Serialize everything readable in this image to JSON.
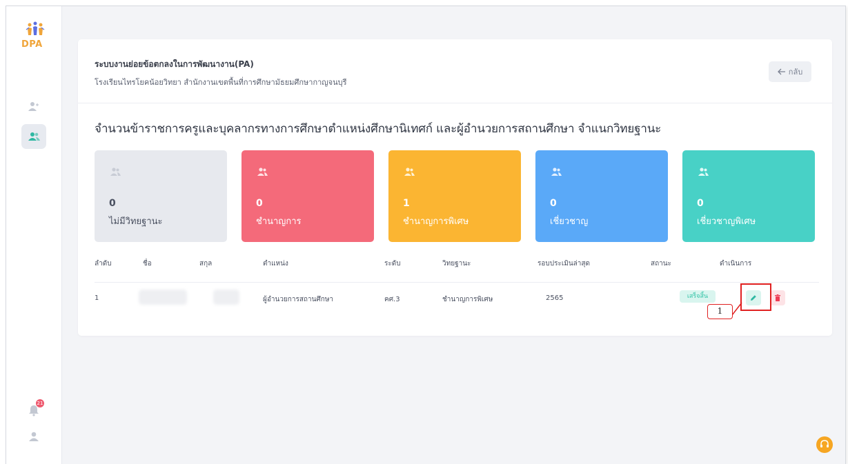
{
  "sidebar": {
    "logo_text": "DPA",
    "items": [
      {
        "name": "add-user",
        "icon": "user-plus-icon"
      },
      {
        "name": "users",
        "icon": "users-icon",
        "active": true
      }
    ],
    "notifications_count": "21"
  },
  "header": {
    "system_title": "ระบบงานย่อยข้อตกลงในการพัฒนางาน(PA)",
    "school": "โรงเรียนไทรโยคน้อยวิทยา สำนักงานเขตพื้นที่การศึกษามัธยมศึกษากาญจนบุรี",
    "back_label": "กลับ"
  },
  "main": {
    "title": "จำนวนข้าราชการครูและบุคลากรทางการศึกษาตำแหน่งศึกษานิเทศก์ และผู้อำนวยการสถานศึกษา จำแนกวิทยฐานะ",
    "stats": [
      {
        "count": "0",
        "label": "ไม่มีวิทยฐานะ",
        "color": "#e7e9ee"
      },
      {
        "count": "0",
        "label": "ชำนาญการ",
        "color": "#f46a7a"
      },
      {
        "count": "1",
        "label": "ชำนาญการพิเศษ",
        "color": "#fbb532"
      },
      {
        "count": "0",
        "label": "เชี่ยวชาญ",
        "color": "#5aa9f8"
      },
      {
        "count": "0",
        "label": "เชี่ยวชาญพิเศษ",
        "color": "#48d1c6"
      }
    ]
  },
  "table": {
    "headers": [
      "ลำดับ",
      "ชื่อ",
      "สกุล",
      "ตำแหน่ง",
      "ระดับ",
      "วิทยฐานะ",
      "รอบประเมินล่าสุด",
      "สถานะ",
      "ดำเนินการ"
    ],
    "rows": [
      {
        "index": "1",
        "position": "ผู้อำนวยการสถานศึกษา",
        "level": "คศ.3",
        "academic_standing": "ชำนาญการพิเศษ",
        "latest_round": "2565",
        "status": "เสร็จสิ้น"
      }
    ]
  },
  "annotation": {
    "callout_label": "1"
  },
  "colors": {
    "accent_green": "#33c3a6",
    "danger": "#e02020",
    "help": "#f6a623"
  }
}
